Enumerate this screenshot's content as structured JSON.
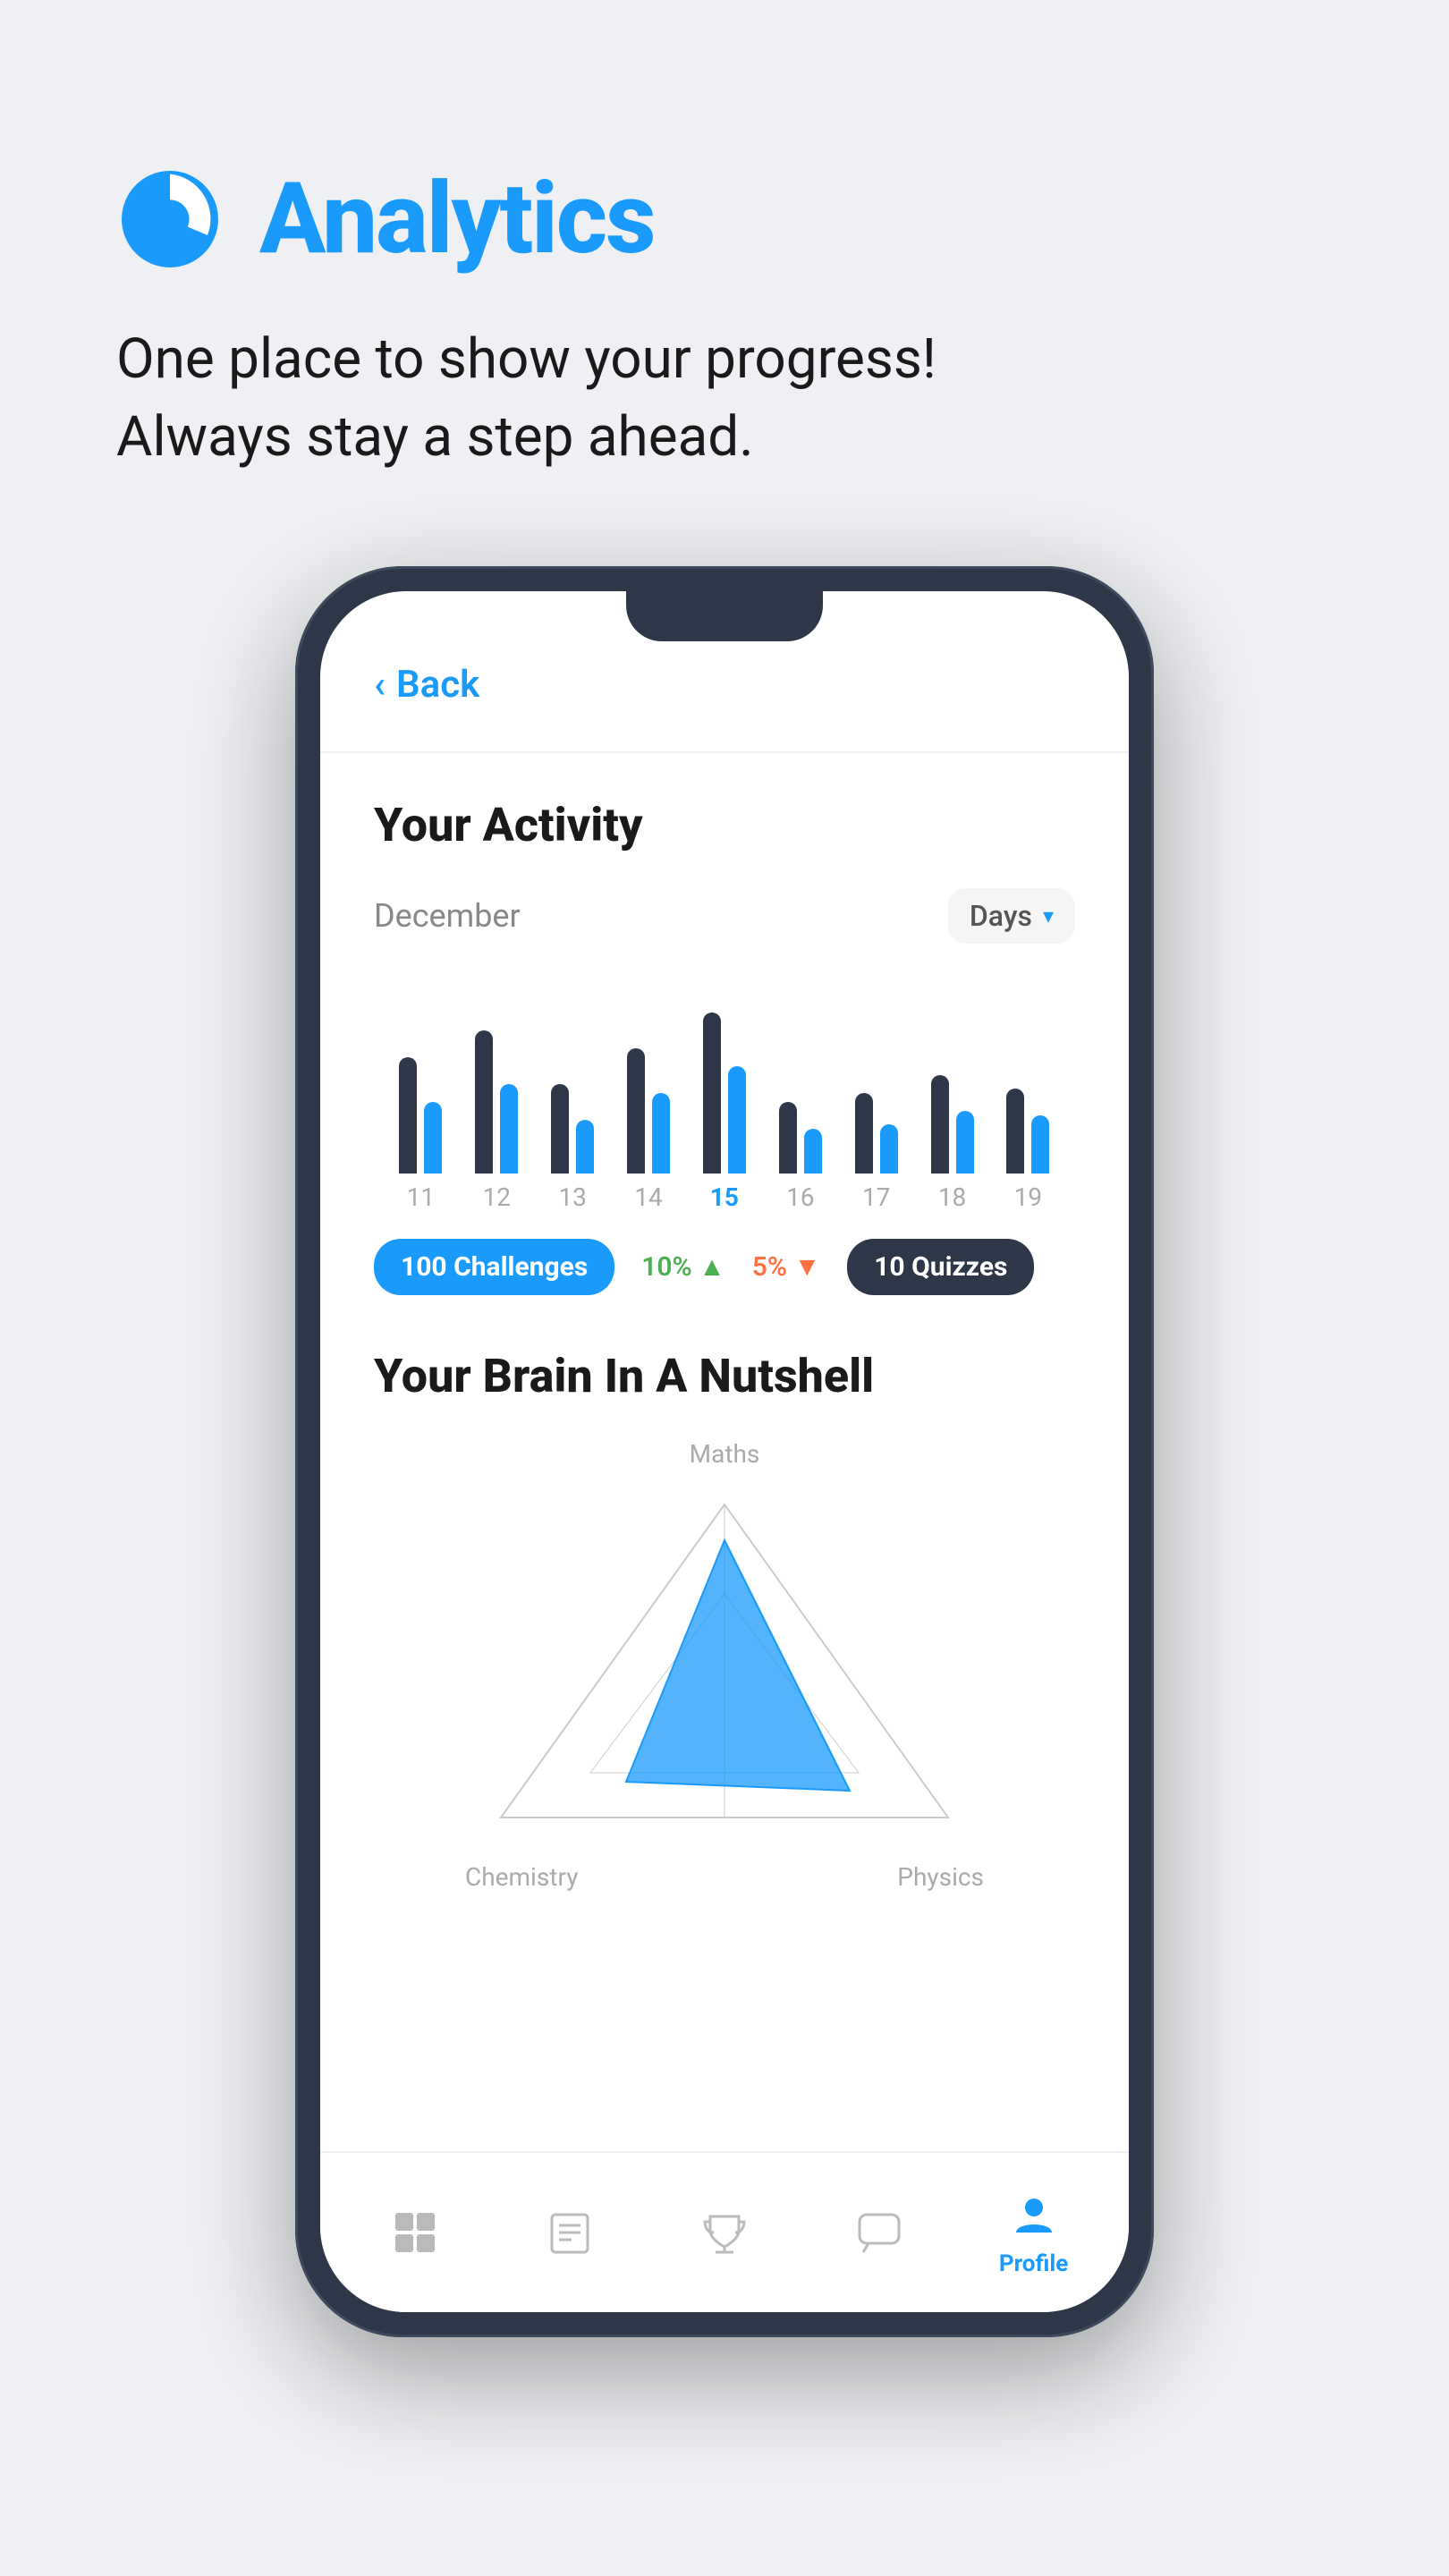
{
  "page": {
    "background": "#eef0f3"
  },
  "header": {
    "icon": "analytics-icon",
    "title": "Analytics",
    "subtitle_line1": "One place to show your progress!",
    "subtitle_line2": "Always stay a step ahead."
  },
  "phone": {
    "back_button": "Back",
    "activity_section": {
      "title": "Your Activity",
      "month": "December",
      "filter": "Days",
      "bars": [
        {
          "day": "11",
          "dark_height": 130,
          "blue_height": 80,
          "active": false
        },
        {
          "day": "12",
          "dark_height": 160,
          "blue_height": 100,
          "active": false
        },
        {
          "day": "13",
          "dark_height": 100,
          "blue_height": 60,
          "active": false
        },
        {
          "day": "14",
          "dark_height": 140,
          "blue_height": 90,
          "active": false
        },
        {
          "day": "15",
          "dark_height": 180,
          "blue_height": 120,
          "active": true
        },
        {
          "day": "16",
          "dark_height": 80,
          "blue_height": 50,
          "active": false
        },
        {
          "day": "17",
          "dark_height": 90,
          "blue_height": 55,
          "active": false
        },
        {
          "day": "18",
          "dark_height": 110,
          "blue_height": 70,
          "active": false
        },
        {
          "day": "19",
          "dark_height": 95,
          "blue_height": 65,
          "active": false
        }
      ],
      "badges": [
        {
          "type": "blue",
          "value": "100",
          "label": "Challenges"
        },
        {
          "type": "stat_green",
          "value": "10%",
          "arrow": "▲"
        },
        {
          "type": "stat_red",
          "value": "5%",
          "arrow": "▼"
        },
        {
          "type": "dark",
          "value": "10",
          "label": "Quizzes"
        }
      ]
    },
    "brain_section": {
      "title": "Your Brain In A Nutshell",
      "radar_labels": {
        "top": "Maths",
        "bottom_left": "Chemistry",
        "bottom_right": "Physics"
      }
    },
    "bottom_nav": [
      {
        "label": "Home",
        "icon": "home-icon",
        "active": false
      },
      {
        "label": "Learn",
        "icon": "learn-icon",
        "active": false
      },
      {
        "label": "Trophy",
        "icon": "trophy-icon",
        "active": false
      },
      {
        "label": "Chat",
        "icon": "chat-icon",
        "active": false
      },
      {
        "label": "Profile",
        "icon": "profile-icon",
        "active": true
      }
    ]
  }
}
